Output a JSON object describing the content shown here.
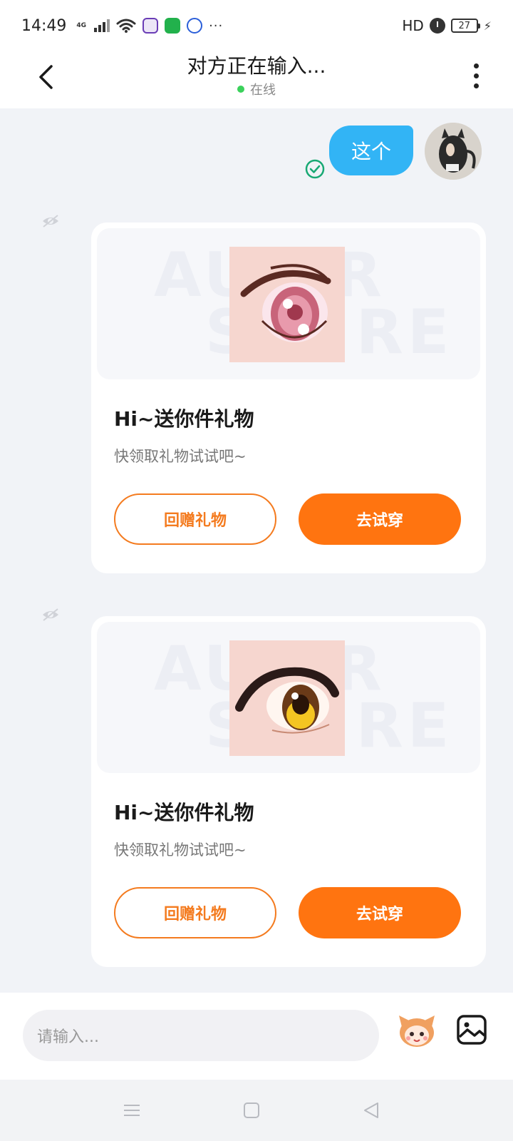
{
  "status_bar": {
    "time": "14:49",
    "network_tag": "4G",
    "more_indicator": "···",
    "hd_label": "HD",
    "battery_level": "27"
  },
  "header": {
    "title": "对方正在输入...",
    "status": "在线",
    "online_color": "#3bd15b"
  },
  "messages": {
    "sent_text": "这个",
    "bubble_color": "#32b4f5"
  },
  "gift_cards": [
    {
      "title": "Hi~送你件礼物",
      "description": "快领取礼物试试吧~",
      "return_gift_label": "回赠礼物",
      "try_on_label": "去试穿",
      "preview": "pink-anime-eye-icon"
    },
    {
      "title": "Hi~送你件礼物",
      "description": "快领取礼物试试吧~",
      "return_gift_label": "回赠礼物",
      "try_on_label": "去试穿",
      "preview": "golden-anime-eye-icon"
    }
  ],
  "input_bar": {
    "placeholder": "请输入..."
  },
  "theme": {
    "accent": "#ff7410",
    "outline": "#f47b1f"
  }
}
